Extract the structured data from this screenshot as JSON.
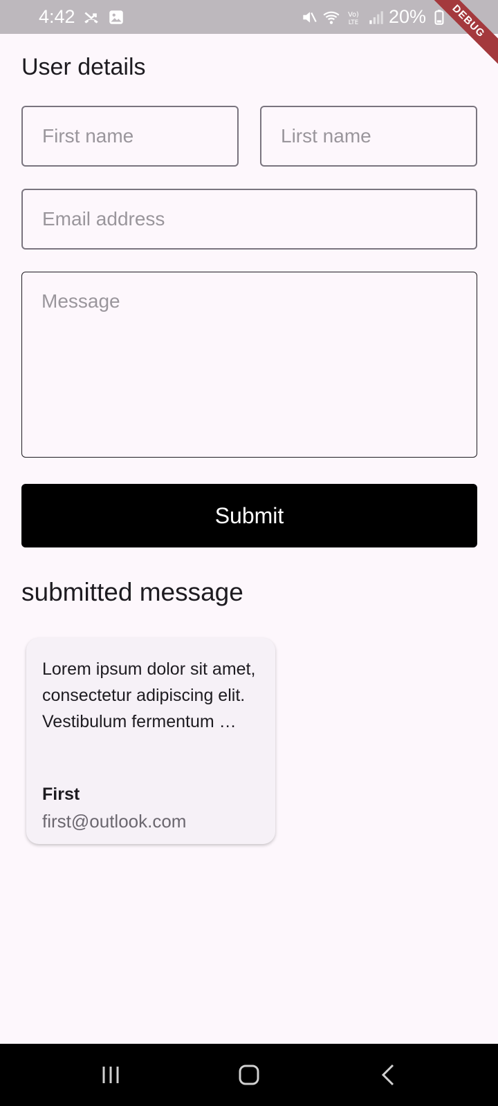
{
  "status_bar": {
    "time": "4:42",
    "battery": "20%",
    "icons": [
      "missed-call-icon",
      "gallery-icon",
      "mute-icon",
      "wifi-icon",
      "volte-icon",
      "signal-icon",
      "battery-icon"
    ]
  },
  "debug_banner": "DEBUG",
  "form": {
    "title": "User details",
    "first_name_placeholder": "First name",
    "last_name_placeholder": "Lirst name",
    "email_placeholder": "Email address",
    "message_placeholder": "Message",
    "submit_label": "Submit"
  },
  "submitted": {
    "title": "submitted message",
    "cards": [
      {
        "message": "Lorem ipsum dolor sit amet, consectetur adipiscing elit. Vestibulum fermentum …",
        "name": "First",
        "email": "first@outlook.com"
      }
    ]
  },
  "nav_bar": {
    "icons": [
      "recents-icon",
      "home-icon",
      "back-icon"
    ]
  },
  "colors": {
    "background": "#fdf7fc",
    "status_bar": "#bdb8bd",
    "button": "#000000",
    "card": "#f6f1f7",
    "debug_banner": "#a4393d"
  }
}
